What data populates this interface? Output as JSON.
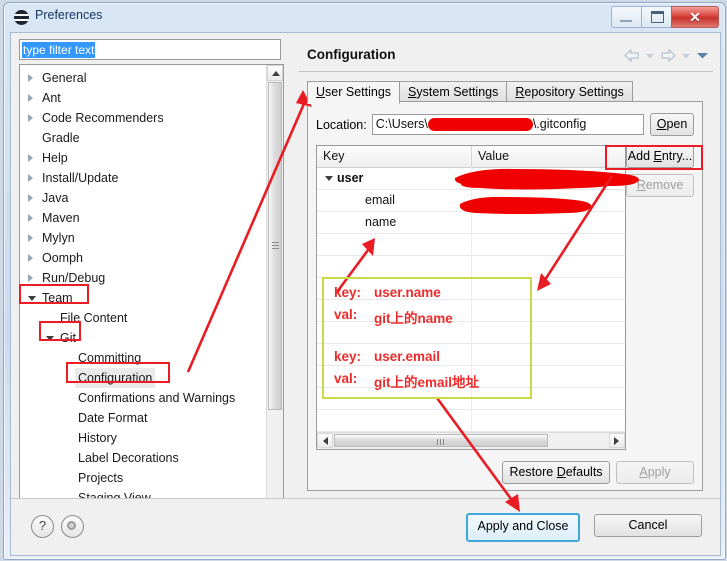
{
  "window": {
    "title": "Preferences",
    "icon": "eclipse-icon",
    "controls": {
      "minimize": "minimize-icon",
      "maximize": "maximize-icon",
      "close": "✕"
    }
  },
  "filter": {
    "value": "type filter text",
    "placeholder": "type filter text"
  },
  "tree": {
    "items": [
      {
        "label": "General",
        "indent": 22,
        "twisty": "closed",
        "highlight": false
      },
      {
        "label": "Ant",
        "indent": 22,
        "twisty": "closed",
        "highlight": false
      },
      {
        "label": "Code Recommenders",
        "indent": 22,
        "twisty": "closed",
        "highlight": false
      },
      {
        "label": "Gradle",
        "indent": 22,
        "twisty": "none",
        "highlight": false
      },
      {
        "label": "Help",
        "indent": 22,
        "twisty": "closed",
        "highlight": false
      },
      {
        "label": "Install/Update",
        "indent": 22,
        "twisty": "closed",
        "highlight": false
      },
      {
        "label": "Java",
        "indent": 22,
        "twisty": "closed",
        "highlight": false
      },
      {
        "label": "Maven",
        "indent": 22,
        "twisty": "closed",
        "highlight": false
      },
      {
        "label": "Mylyn",
        "indent": 22,
        "twisty": "closed",
        "highlight": false
      },
      {
        "label": "Oomph",
        "indent": 22,
        "twisty": "closed",
        "highlight": false
      },
      {
        "label": "Run/Debug",
        "indent": 22,
        "twisty": "closed",
        "highlight": false
      },
      {
        "label": "Team",
        "indent": 22,
        "twisty": "open",
        "highlight": true
      },
      {
        "label": "File Content",
        "indent": 40,
        "twisty": "none",
        "highlight": false
      },
      {
        "label": "Git",
        "indent": 40,
        "twisty": "open",
        "highlight": true
      },
      {
        "label": "Committing",
        "indent": 58,
        "twisty": "none",
        "highlight": false
      },
      {
        "label": "Configuration",
        "indent": 58,
        "twisty": "none",
        "highlight": true,
        "selected": true
      },
      {
        "label": "Confirmations and Warnings",
        "indent": 58,
        "twisty": "none",
        "highlight": false
      },
      {
        "label": "Date Format",
        "indent": 58,
        "twisty": "none",
        "highlight": false
      },
      {
        "label": "History",
        "indent": 58,
        "twisty": "none",
        "highlight": false
      },
      {
        "label": "Label Decorations",
        "indent": 58,
        "twisty": "none",
        "highlight": false
      },
      {
        "label": "Projects",
        "indent": 58,
        "twisty": "none",
        "highlight": false
      },
      {
        "label": "Staging View",
        "indent": 58,
        "twisty": "none",
        "highlight": false
      }
    ]
  },
  "page": {
    "title": "Configuration",
    "nav": {
      "back": "back-arrow-icon",
      "back_menu": "chevron-down-icon",
      "forward": "forward-arrow-icon",
      "forward_menu": "chevron-down-icon",
      "view_menu": "chevron-down-icon"
    },
    "tabs": [
      {
        "label": "User Settings",
        "mnemonic": "U",
        "active": true
      },
      {
        "label": "System Settings",
        "mnemonic": "S",
        "active": false
      },
      {
        "label": "Repository Settings",
        "mnemonic": "R",
        "active": false
      }
    ],
    "location": {
      "label": "Location:",
      "prefix": "C:\\Users\\",
      "suffix": "\\.gitconfig",
      "redacted": true,
      "open_button": "Open",
      "open_mnemonic": "O"
    },
    "table": {
      "columns": [
        "Key",
        "Value"
      ],
      "rows": [
        {
          "key": "user",
          "indent": 20,
          "twisty": "open",
          "bold": true,
          "value": "",
          "redacted": false
        },
        {
          "key": "email",
          "indent": 48,
          "twisty": "none",
          "bold": false,
          "value": "",
          "redacted": true
        },
        {
          "key": "name",
          "indent": 48,
          "twisty": "none",
          "bold": false,
          "value": "",
          "redacted": true
        },
        {
          "key": "",
          "indent": 48,
          "twisty": "none",
          "bold": false,
          "value": "",
          "redacted": false
        },
        {
          "key": "",
          "indent": 48,
          "twisty": "none",
          "bold": false,
          "value": "",
          "redacted": false
        },
        {
          "key": "",
          "indent": 48,
          "twisty": "none",
          "bold": false,
          "value": "",
          "redacted": false
        },
        {
          "key": "",
          "indent": 48,
          "twisty": "none",
          "bold": false,
          "value": "",
          "redacted": false
        },
        {
          "key": "",
          "indent": 48,
          "twisty": "none",
          "bold": false,
          "value": "",
          "redacted": false
        },
        {
          "key": "",
          "indent": 48,
          "twisty": "none",
          "bold": false,
          "value": "",
          "redacted": false
        },
        {
          "key": "",
          "indent": 48,
          "twisty": "none",
          "bold": false,
          "value": "",
          "redacted": false
        },
        {
          "key": "",
          "indent": 48,
          "twisty": "none",
          "bold": false,
          "value": "",
          "redacted": false
        },
        {
          "key": "",
          "indent": 48,
          "twisty": "none",
          "bold": false,
          "value": "",
          "redacted": false
        }
      ]
    },
    "side_buttons": {
      "add_entry": "Add Entry...",
      "add_entry_mnemonic": "E",
      "remove": "Remove",
      "remove_mnemonic": "R",
      "remove_disabled": true
    },
    "bottom_buttons": {
      "restore_defaults": "Restore Defaults",
      "restore_mnemonic": "D",
      "apply": "Apply",
      "apply_mnemonic": "A",
      "apply_disabled": true
    }
  },
  "footer": {
    "help": "?",
    "help_icon": "question-mark-icon",
    "secondary_icon": "record-dot-icon",
    "apply_and_close": "Apply and Close",
    "cancel": "Cancel"
  },
  "annotations": {
    "highlight_color": "#ec1c24",
    "note_border_color": "#c8d94a",
    "note_text_color": "#ee2b2b",
    "note_lines": [
      {
        "key": "key:",
        "val": "user.name"
      },
      {
        "key": "val:",
        "val": "git上的name"
      },
      {
        "key": "",
        "val": ""
      },
      {
        "key": "key:",
        "val": "user.email"
      },
      {
        "key": "val:",
        "val": "git上的email地址"
      }
    ]
  }
}
